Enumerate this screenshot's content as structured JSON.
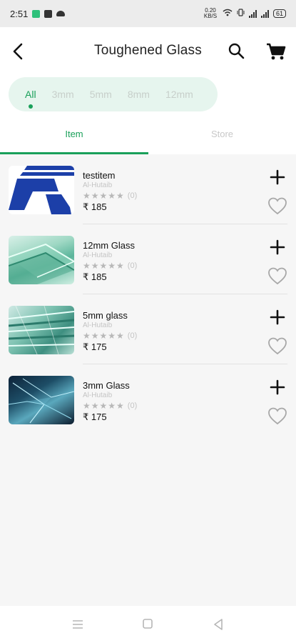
{
  "status_bar": {
    "time": "2:51",
    "net_speed": "0.20 KB/S",
    "battery": "61"
  },
  "header": {
    "title": "Toughened Glass",
    "back_icon": "arrow-back-icon",
    "search_icon": "search-icon",
    "cart_icon": "cart-icon"
  },
  "filters": {
    "chips": [
      "All",
      "3mm",
      "5mm",
      "8mm",
      "12mm"
    ],
    "selected": "All"
  },
  "tabs": {
    "items": [
      "Item",
      "Store"
    ],
    "active": "Item"
  },
  "products": [
    {
      "name": "testitem",
      "store": "Al-Hutaib",
      "stars": "★★★★★",
      "rating_count": "(0)",
      "price": "₹ 185"
    },
    {
      "name": "12mm Glass",
      "store": "Al-Hutaib",
      "stars": "★★★★★",
      "rating_count": "(0)",
      "price": "₹ 185"
    },
    {
      "name": "5mm glass",
      "store": "Al-Hutaib",
      "stars": "★★★★★",
      "rating_count": "(0)",
      "price": "₹ 175"
    },
    {
      "name": "3mm Glass",
      "store": "Al-Hutaib",
      "stars": "★★★★★",
      "rating_count": "(0)",
      "price": "₹ 175"
    }
  ],
  "colors": {
    "accent": "#1aa05a",
    "chip_bg": "#e6f5ee",
    "logo_blue": "#1c3fa8"
  }
}
